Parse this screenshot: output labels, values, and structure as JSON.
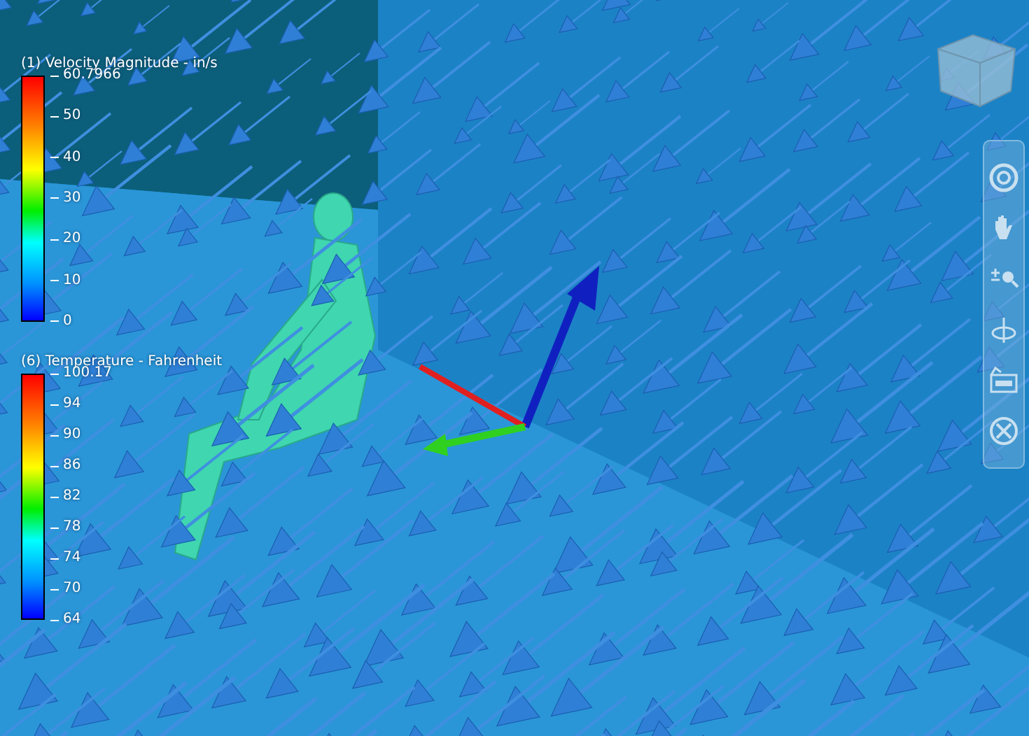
{
  "legends": [
    {
      "title": "(1) Velocity Magnitude - in/s",
      "ticks": [
        "60.7966",
        "50",
        "40",
        "30",
        "20",
        "10",
        "0"
      ]
    },
    {
      "title": "(6) Temperature - Fahrenheit",
      "ticks": [
        "100.17",
        "94",
        "90",
        "86",
        "82",
        "78",
        "74",
        "70",
        "64"
      ]
    }
  ]
}
